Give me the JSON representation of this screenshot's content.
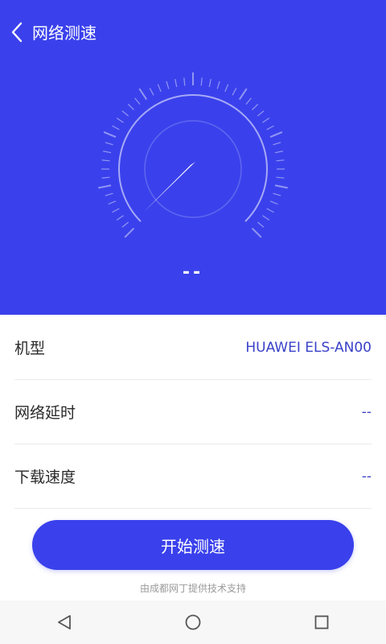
{
  "header": {
    "title": "网络测速",
    "back_icon": "chevron-left-icon"
  },
  "gauge": {
    "speed_display": "--",
    "needle_icon": "speedometer-needle"
  },
  "info_rows": [
    {
      "label": "机型",
      "value": "HUAWEI ELS-AN00"
    },
    {
      "label": "网络延时",
      "value": "--"
    },
    {
      "label": "下载速度",
      "value": "--"
    }
  ],
  "actions": {
    "start_label": "开始测速"
  },
  "footer": {
    "provider_text": "由成都网丁提供技术支持"
  },
  "system_nav": {
    "back": "triangle-back-icon",
    "home": "circle-home-icon",
    "recents": "square-recents-icon"
  },
  "colors": {
    "primary": "#3a41ec",
    "value_text": "#3a41c8"
  }
}
